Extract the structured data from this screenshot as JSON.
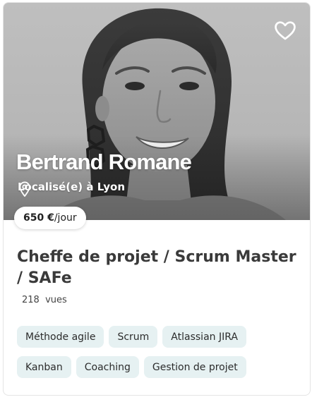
{
  "profile": {
    "name": "Bertrand Romane",
    "location": "Localisé(e) à Lyon",
    "rate_amount": "650 €",
    "rate_unit": "/jour",
    "title": "Cheffe de projet / Scrum Master / SAFe",
    "views_count": "218",
    "views_label": "vues"
  },
  "tags": [
    "Méthode agile",
    "Scrum",
    "Atlassian JIRA",
    "Kanban",
    "Coaching",
    "Gestion de projet"
  ],
  "icons": {
    "favorite": "heart-outline-icon",
    "location": "map-pin-icon"
  },
  "colors": {
    "tag_background": "#e6f1f2",
    "title_text": "#3a3a3a"
  }
}
